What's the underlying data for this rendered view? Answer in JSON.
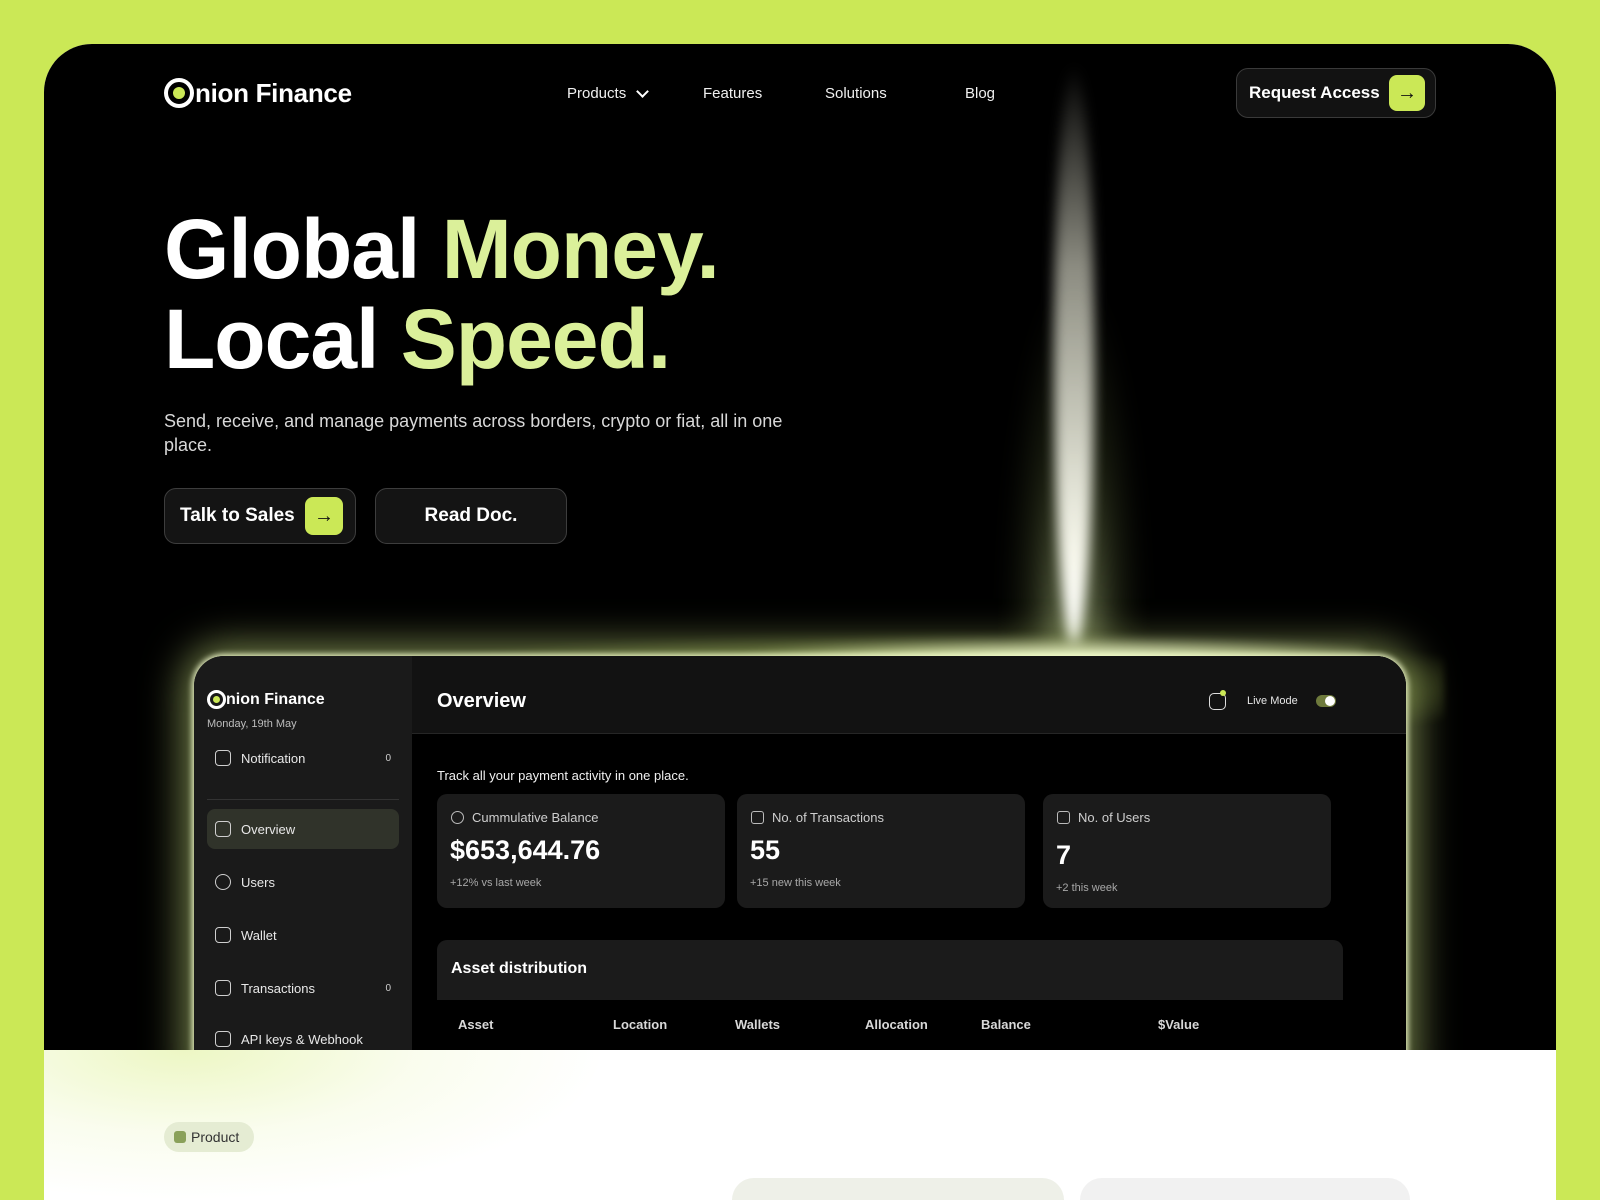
{
  "brand": {
    "name": "nion Finance",
    "logo_icon": "onion-logo-icon"
  },
  "nav": {
    "items": [
      {
        "label": "Products"
      },
      {
        "label": "Features"
      },
      {
        "label": "Solutions"
      },
      {
        "label": "Blog"
      }
    ],
    "cta_label": "Request Access"
  },
  "hero": {
    "line1_white": "Global ",
    "line1_accent": "Money.",
    "line2_white": "Local ",
    "line2_accent": "Speed.",
    "subtitle": "Send, receive, and manage payments across borders, crypto or fiat, all in one place.",
    "primary_cta": "Talk to Sales",
    "secondary_cta": "Read Doc."
  },
  "dashboard": {
    "brand": "nion Finance",
    "date": "Monday, 19th May",
    "sidebar": {
      "notification": {
        "label": "Notification",
        "count": "0"
      },
      "items": [
        {
          "label": "Overview",
          "icon": "overview-icon"
        },
        {
          "label": "Users",
          "icon": "user-icon"
        },
        {
          "label": "Wallet",
          "icon": "wallet-icon"
        },
        {
          "label": "Transactions",
          "icon": "receipt-icon",
          "count": "0"
        },
        {
          "label": "API keys & Webhook",
          "icon": "terminal-icon"
        }
      ]
    },
    "title": "Overview",
    "live_mode_label": "Live Mode",
    "live_mode_on": true,
    "tagline": "Track all your payment activity in one place.",
    "cards": [
      {
        "label": "Cummulative Balance",
        "value": "$653,644.76",
        "sub": "+12% vs last week",
        "icon": "dollar-circle-icon"
      },
      {
        "label": "No. of Transactions",
        "value": "55",
        "sub": "+15 new this week",
        "icon": "grid-icon"
      },
      {
        "label": "No. of Users",
        "value": "7",
        "sub": "+2 this week",
        "icon": "users-icon"
      }
    ],
    "asset_title": "Asset distribution",
    "table_headers": [
      "Asset",
      "Location",
      "Wallets",
      "Allocation",
      "Balance",
      "$Value"
    ]
  },
  "lower": {
    "badge": "Product"
  },
  "colors": {
    "accent": "#cbe856",
    "accent_text": "#dbf09a",
    "background": "#000000"
  }
}
